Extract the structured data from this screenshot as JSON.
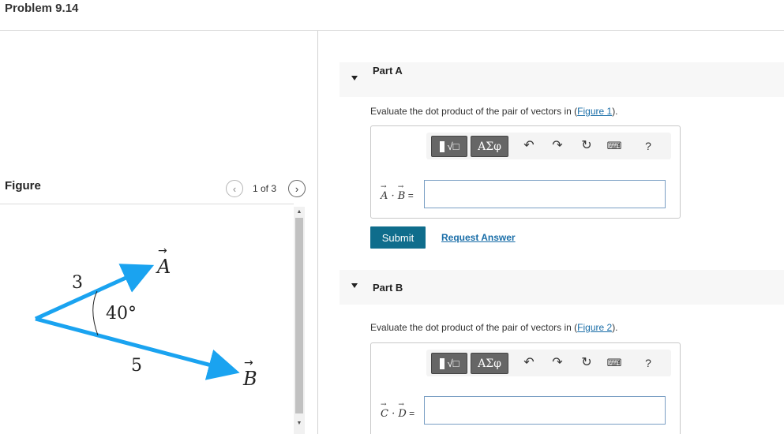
{
  "page": {
    "title": "Problem 9.14"
  },
  "figure": {
    "label": "Figure",
    "counter": "1 of 3",
    "prev_icon": "chevron-left-icon",
    "next_icon": "chevron-right-icon",
    "labels": {
      "vec_a": "A",
      "vec_b": "B",
      "mag_a": "3",
      "mag_b": "5",
      "angle": "40°"
    },
    "arrow_color": "#1aa3f0"
  },
  "part_a": {
    "title": "Part A",
    "prompt_prefix": "Evaluate the dot product of the pair of vectors in (",
    "prompt_link": "Figure 1",
    "prompt_suffix": ").",
    "expr_v1": "A",
    "expr_dot": " · ",
    "expr_v2": "B",
    "expr_eq": " =",
    "input_value": ""
  },
  "part_b": {
    "title": "Part B",
    "prompt_prefix": "Evaluate the dot product of the pair of vectors in (",
    "prompt_link": "Figure 2",
    "prompt_suffix": ").",
    "expr_v1": "C",
    "expr_dot": " · ",
    "expr_v2": "D",
    "expr_eq": " =",
    "input_value": ""
  },
  "toolbar": {
    "templates_label": "√□",
    "greek_label": "ΑΣφ",
    "undo_icon": "undo-icon",
    "redo_icon": "redo-icon",
    "reset_icon": "reset-icon",
    "keyboard_icon": "keyboard-icon",
    "help_label": "?"
  },
  "actions": {
    "submit_label": "Submit",
    "request_label": "Request Answer"
  },
  "colors": {
    "submit_bg": "#0f6d8c",
    "link": "#1a6ea8"
  }
}
